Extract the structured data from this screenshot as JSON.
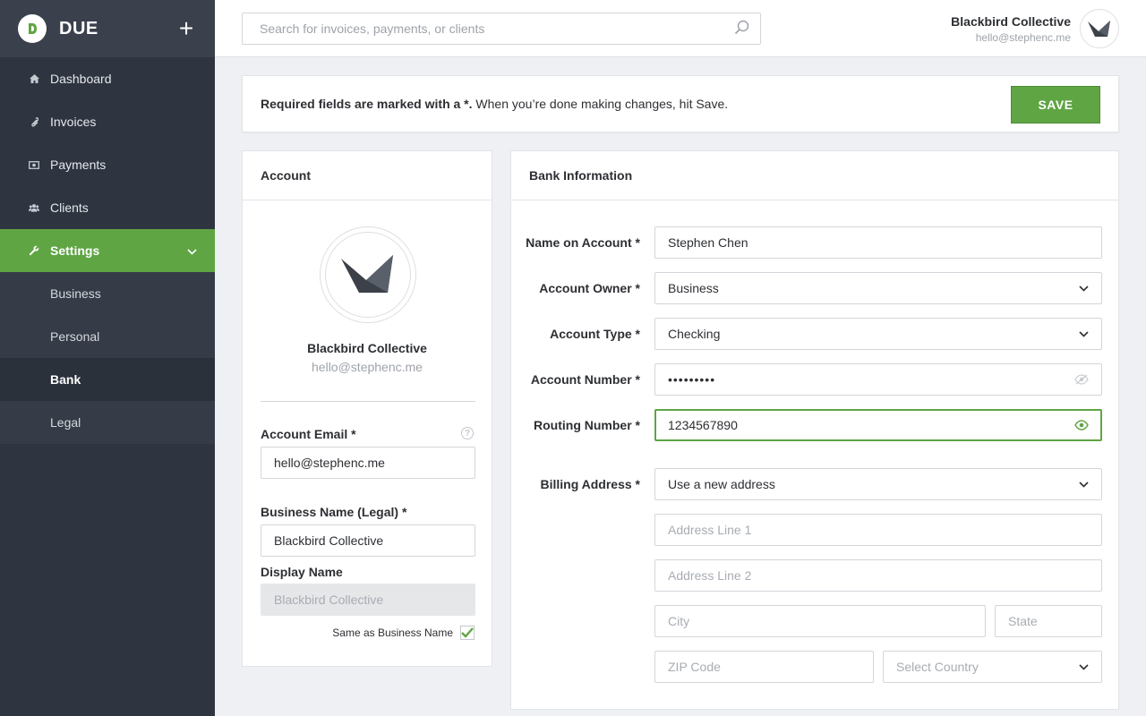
{
  "brand": {
    "name": "DUE",
    "plus": "+"
  },
  "sidebar": {
    "items": [
      {
        "label": "Dashboard",
        "icon": "home-icon"
      },
      {
        "label": "Invoices",
        "icon": "paperclip-icon"
      },
      {
        "label": "Payments",
        "icon": "money-icon"
      },
      {
        "label": "Clients",
        "icon": "users-icon"
      },
      {
        "label": "Settings",
        "icon": "wrench-icon"
      }
    ],
    "settings_sub": [
      "Business",
      "Personal",
      "Bank",
      "Legal"
    ]
  },
  "topbar": {
    "search_placeholder": "Search for invoices, payments, or clients",
    "user_name": "Blackbird Collective",
    "user_email": "hello@stephenc.me"
  },
  "notice": {
    "bold": "Required fields are marked with a *.",
    "rest": " When you’re done making changes, hit Save.",
    "save": "SAVE"
  },
  "account": {
    "title": "Account",
    "name": "Blackbird Collective",
    "email": "hello@stephenc.me",
    "email_label": "Account Email *",
    "email_value": "hello@stephenc.me",
    "business_label": "Business Name (Legal) *",
    "business_value": "Blackbird Collective",
    "display_label": "Display Name",
    "display_value": "Blackbird Collective",
    "same_label": "Same as Business Name",
    "same_checked": true,
    "help": "?"
  },
  "bank": {
    "title": "Bank Information",
    "name_label": "Name on Account *",
    "name_value": "Stephen Chen",
    "owner_label": "Account Owner *",
    "owner_value": "Business",
    "type_label": "Account Type *",
    "type_value": "Checking",
    "number_label": "Account Number *",
    "number_value": "•••••••••",
    "routing_label": "Routing Number *",
    "routing_value": "1234567890",
    "billing_label": "Billing Address *",
    "billing_value": "Use a new address",
    "addr1_ph": "Address Line 1",
    "addr2_ph": "Address Line 2",
    "city_ph": "City",
    "state_ph": "State",
    "zip_ph": "ZIP Code",
    "country_ph": "Select Country"
  },
  "colors": {
    "accent": "#5fa544",
    "sidebar": "#2e3440"
  }
}
